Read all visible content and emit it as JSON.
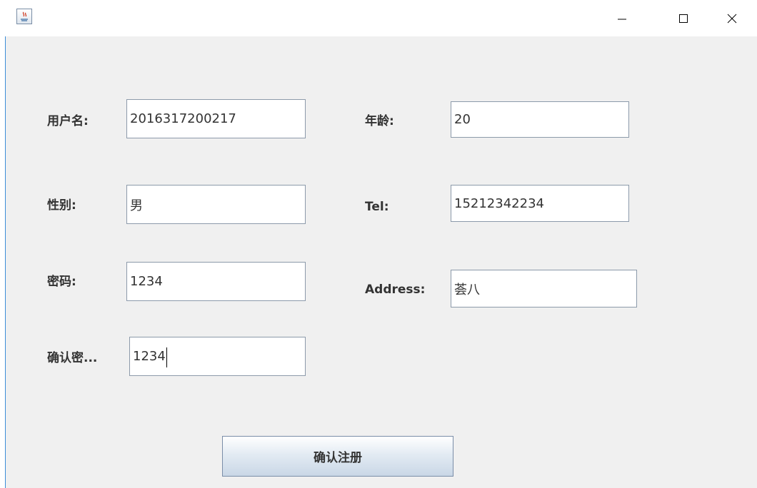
{
  "window": {
    "controls": {
      "minimize": "—",
      "maximize": "☐",
      "close": "✕"
    }
  },
  "form": {
    "username": {
      "label": "用户名:",
      "value": "2016317200217"
    },
    "age": {
      "label": "年龄:",
      "value": "20"
    },
    "gender": {
      "label": "性别:",
      "value": "男"
    },
    "tel": {
      "label": "Tel:",
      "value": "15212342234"
    },
    "password": {
      "label": "密码:",
      "value": "1234"
    },
    "address": {
      "label": "Address:",
      "value": "荟八"
    },
    "confirm_password": {
      "label": "确认密...",
      "value": "1234"
    },
    "submit_label": "确认注册"
  },
  "colors": {
    "background": "#f0f0f0",
    "field_border": "#8c9aaa",
    "window_edge": "#3c8dd8"
  }
}
